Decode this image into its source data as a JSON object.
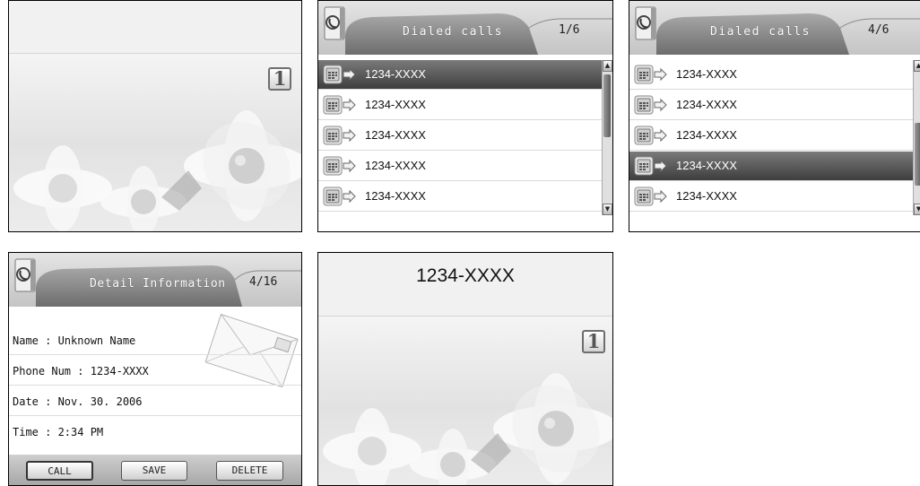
{
  "idle": {
    "line_badge": "1"
  },
  "dialed_list_a": {
    "title": "Dialed calls",
    "page": "1/6",
    "rows": [
      "1234-XXXX",
      "1234-XXXX",
      "1234-XXXX",
      "1234-XXXX",
      "1234-XXXX"
    ],
    "selected_index": 0
  },
  "dialed_list_b": {
    "title": "Dialed calls",
    "page": "4/6",
    "rows": [
      "1234-XXXX",
      "1234-XXXX",
      "1234-XXXX",
      "1234-XXXX",
      "1234-XXXX"
    ],
    "selected_index": 3
  },
  "detail": {
    "title": "Detail Information",
    "page": "4/16",
    "name": "Name : Unknown Name",
    "phone": "Phone Num : 1234-XXXX",
    "date": "Date : Nov. 30. 2006",
    "time": "Time : 2:34 PM",
    "buttons": {
      "call": "CALL",
      "save": "SAVE",
      "delete": "DELETE"
    }
  },
  "dialing": {
    "number": "1234-XXXX",
    "line_badge": "1"
  },
  "icons": {
    "phone": "phone-handset-icon",
    "call_log_entry": "outgoing-call-icon",
    "scroll_up": "scroll-up-arrow-icon",
    "scroll_down": "scroll-down-arrow-icon",
    "envelope": "envelope-icon"
  }
}
